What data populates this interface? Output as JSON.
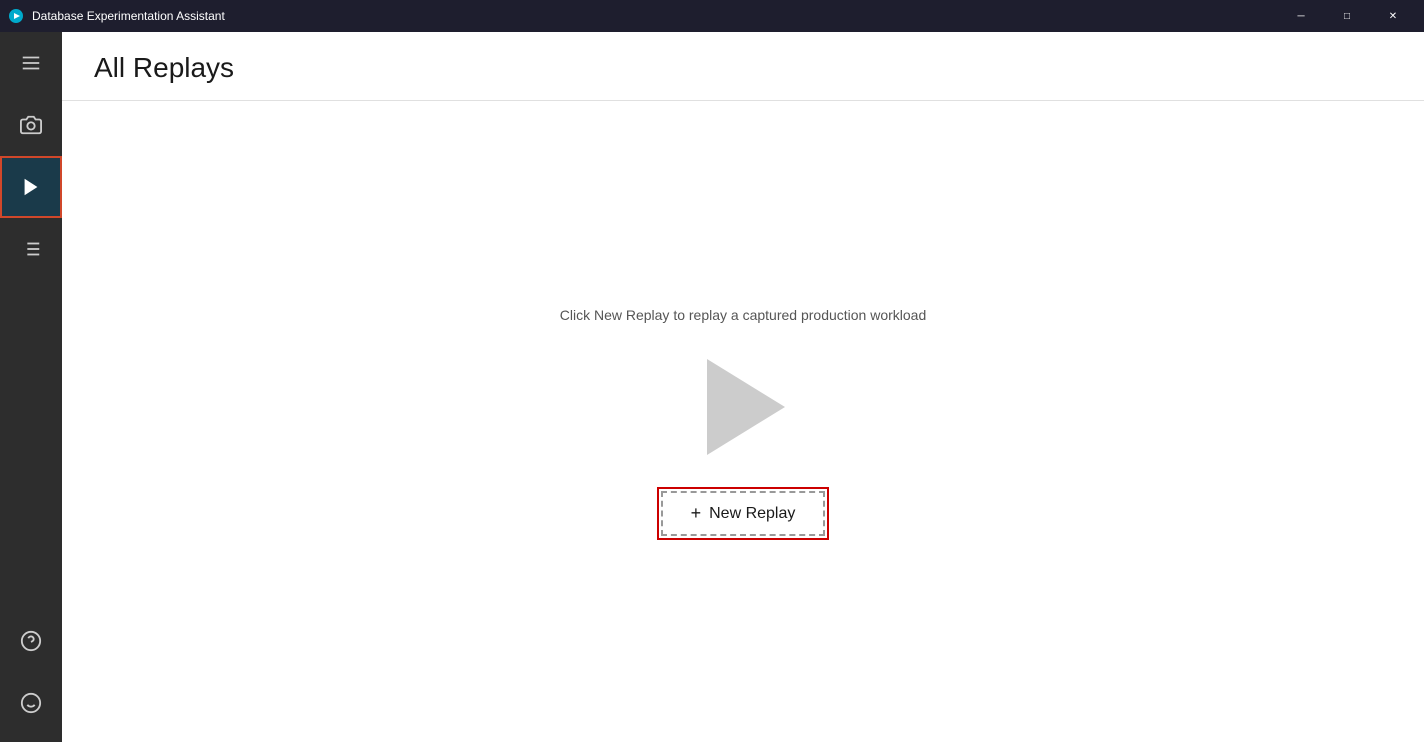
{
  "titlebar": {
    "title": "Database Experimentation Assistant",
    "minimize_label": "─",
    "maximize_label": "□",
    "close_label": "✕"
  },
  "sidebar": {
    "items": [
      {
        "id": "menu",
        "icon": "menu-icon",
        "label": "Menu",
        "active": false
      },
      {
        "id": "capture",
        "icon": "camera-icon",
        "label": "Capture",
        "active": false
      },
      {
        "id": "replay",
        "icon": "play-icon",
        "label": "Replay",
        "active": true
      },
      {
        "id": "analysis",
        "icon": "analysis-icon",
        "label": "Analysis",
        "active": false
      }
    ],
    "bottom_items": [
      {
        "id": "help",
        "icon": "help-icon",
        "label": "Help"
      },
      {
        "id": "feedback",
        "icon": "feedback-icon",
        "label": "Feedback"
      }
    ]
  },
  "page": {
    "title": "All Replays",
    "hint_text": "Click New Replay to replay a captured production workload",
    "new_replay_label": "New Replay"
  }
}
